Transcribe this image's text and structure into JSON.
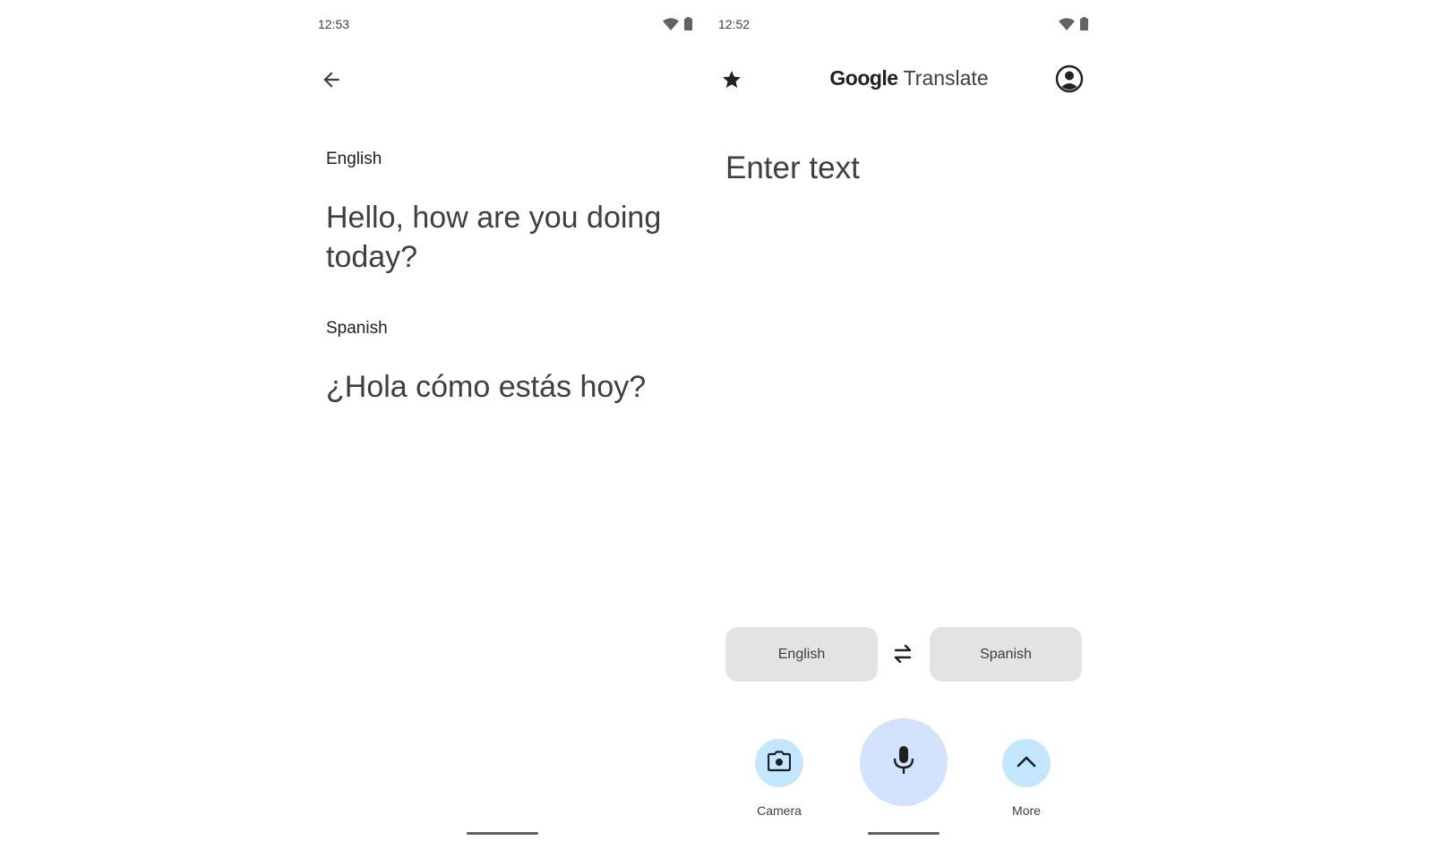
{
  "left_screen": {
    "status_time": "12:53",
    "source_label": "English",
    "source_text": "Hello, how are you doing today?",
    "target_label": "Spanish",
    "target_text": "¿Hola cómo estás hoy?",
    "icons": [
      "arrow-back-icon",
      "wifi-icon",
      "battery-icon"
    ]
  },
  "right_screen": {
    "status_time": "12:52",
    "logo_brand": "Google",
    "logo_product": "Translate",
    "input_placeholder": "Enter text",
    "source_language": "English",
    "target_language": "Spanish",
    "camera_label": "Camera",
    "more_label": "More",
    "icons": [
      "star-icon",
      "account-circle-icon",
      "swap-icon",
      "camera-icon",
      "mic-icon",
      "chevron-up-icon",
      "wifi-icon",
      "battery-icon"
    ]
  },
  "colors": {
    "text": "#3c4043",
    "pill_bg": "#e3e3e3",
    "action_bg": "#c2e7ff",
    "mic_bg": "#d3e3fd",
    "icon_dark": "#202124"
  }
}
